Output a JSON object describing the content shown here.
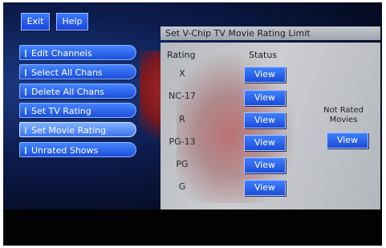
{
  "top_buttons": {
    "exit": "Exit",
    "help": "Help"
  },
  "menu": [
    {
      "label": "Edit Channels"
    },
    {
      "label": "Select All Chans"
    },
    {
      "label": "Delete All Chans"
    },
    {
      "label": "Set TV Rating"
    },
    {
      "label": "Set Movie Rating",
      "selected": true
    },
    {
      "label": "Unrated Shows"
    }
  ],
  "panel": {
    "title": "Set V-Chip TV Movie Rating Limit",
    "rating_header": "Rating",
    "status_header": "Status",
    "rows": [
      {
        "rating": "X",
        "status": "View"
      },
      {
        "rating": "NC-17",
        "status": "View"
      },
      {
        "rating": "R",
        "status": "View"
      },
      {
        "rating": "PG-13",
        "status": "View"
      },
      {
        "rating": "PG",
        "status": "View"
      },
      {
        "rating": "G",
        "status": "View"
      }
    ],
    "not_rated": {
      "line1": "Not Rated",
      "line2": "Movies",
      "status": "View"
    }
  }
}
